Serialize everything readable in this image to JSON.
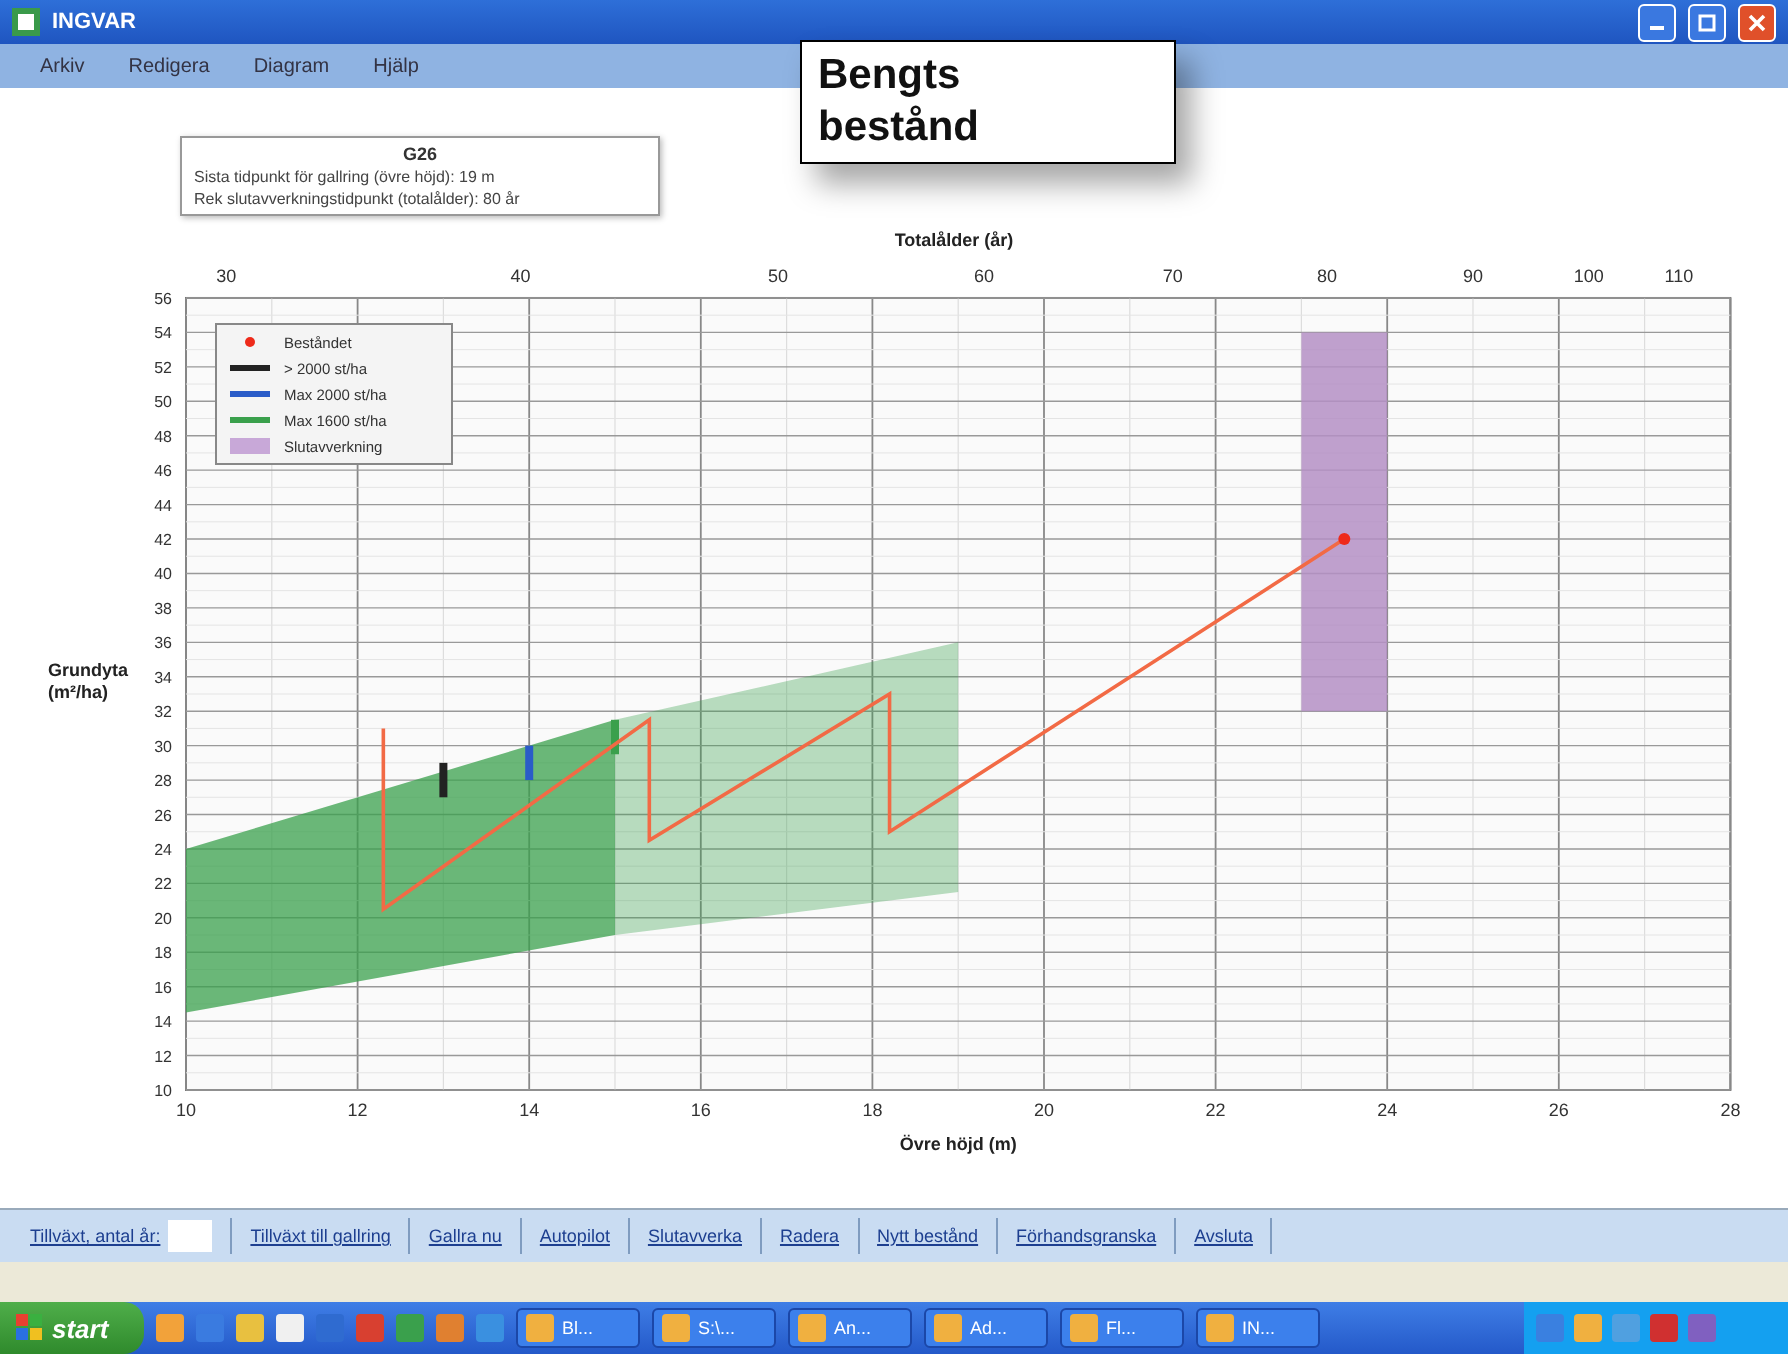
{
  "window": {
    "title": "INGVAR"
  },
  "menu": [
    "Arkiv",
    "Redigera",
    "Diagram",
    "Hjälp"
  ],
  "callout": {
    "lines": [
      "Bengts",
      "bestånd"
    ]
  },
  "info_box": {
    "title": "G26",
    "lines": [
      "Sista tidpunkt för gallring (övre höjd): 19 m",
      "Rek slutavverkningstidpunkt (totalålder): 80 år"
    ]
  },
  "chart": {
    "chart_data": {
      "type": "line",
      "xlabel": "Övre höjd (m)",
      "ylabel": "Grundyta (m²/ha)",
      "xlim": [
        10,
        28
      ],
      "ylim": [
        10,
        56
      ],
      "grid": true,
      "xticks": [
        10,
        12,
        14,
        16,
        18,
        20,
        22,
        24,
        26,
        28
      ],
      "yticks": [
        10,
        12,
        14,
        16,
        18,
        20,
        22,
        24,
        26,
        28,
        30,
        32,
        34,
        36,
        38,
        40,
        42,
        44,
        46,
        48,
        50,
        52,
        54,
        56
      ],
      "x": [
        12.3,
        12.3,
        15.4,
        15.4,
        18.2,
        18.2,
        23.5
      ],
      "series": [
        {
          "name": "Beståndet",
          "color": "#f26a45",
          "values": [
            31,
            20.5,
            31.5,
            24.5,
            33,
            25,
            42
          ]
        }
      ]
    },
    "top_axis": {
      "title": "Totalålder (år)",
      "ticks": [
        "30",
        "40",
        "50",
        "60",
        "70",
        "80",
        "90",
        "100",
        "110"
      ]
    },
    "legend": [
      {
        "kind": "series",
        "color": "#ee2a1a"
      },
      {
        "kind": "line",
        "label": "> 2000 st/ha",
        "color": "#222222"
      },
      {
        "kind": "line",
        "label": "Max 2000 st/ha",
        "color": "#2a5cc8"
      },
      {
        "kind": "line",
        "label": "Max 1600 st/ha",
        "color": "#3aa04c"
      },
      {
        "kind": "swatch",
        "label": "Slutavverkning",
        "color": "#c8a8d8"
      }
    ]
  },
  "actions": [
    {
      "kind": "input",
      "label": "Tillväxt, antal år:"
    },
    {
      "kind": "link",
      "label": "Tillväxt till gallring"
    },
    {
      "kind": "link",
      "label": "Gallra nu"
    },
    {
      "kind": "link",
      "label": "Autopilot"
    },
    {
      "kind": "link",
      "label": "Slutavverka"
    },
    {
      "kind": "link",
      "label": "Radera"
    },
    {
      "kind": "link",
      "label": "Nytt bestånd"
    },
    {
      "kind": "link",
      "label": "Förhandsgranska"
    },
    {
      "kind": "link",
      "label": "Avsluta"
    }
  ],
  "taskbar": {
    "start": "start",
    "tasks": [
      {
        "label": "Bl..."
      },
      {
        "label": "S:\\..."
      },
      {
        "label": "An..."
      },
      {
        "label": "Ad..."
      },
      {
        "label": "Fl..."
      },
      {
        "label": "IN..."
      }
    ]
  }
}
